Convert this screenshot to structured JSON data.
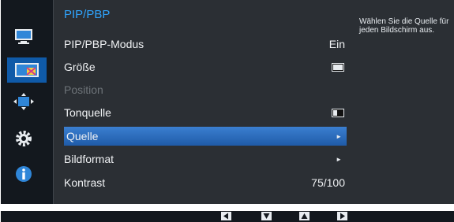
{
  "menu": {
    "title": "PIP/PBP",
    "items": [
      {
        "label": "PIP/PBP-Modus",
        "value": "Ein"
      },
      {
        "label": "Größe",
        "value": ""
      },
      {
        "label": "Position",
        "value": ""
      },
      {
        "label": "Tonquelle",
        "value": ""
      },
      {
        "label": "Quelle",
        "value": "►"
      },
      {
        "label": "Bildformat",
        "value": "►"
      },
      {
        "label": "Kontrast",
        "value": "75/100"
      }
    ]
  },
  "help": {
    "text": "Wählen Sie die Quelle für jeden Bildschirm aus."
  },
  "side_icons": [
    "monitor-icon",
    "pip-screen-icon",
    "screen-arrows-icon",
    "gear-icon",
    "info-icon"
  ],
  "nav_buttons": [
    "left-arrow",
    "down-arrow",
    "up-arrow",
    "right-arrow"
  ],
  "colors": {
    "accent": "#2fa5ff",
    "selected": "#2b6fc2",
    "panel": "#2b2f34",
    "background": "#13181e"
  }
}
